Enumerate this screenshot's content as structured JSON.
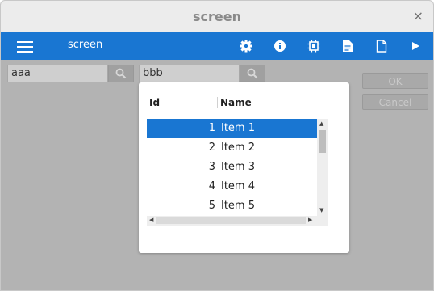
{
  "window": {
    "title": "screen",
    "close_glyph": "×"
  },
  "toolbar": {
    "app_name": "screen",
    "icons": [
      "menu-icon",
      "gear-icon",
      "info-icon",
      "chip-icon",
      "document-text-icon",
      "document-icon",
      "play-icon"
    ]
  },
  "search1": {
    "value": "aaa"
  },
  "search2": {
    "value": "bbb"
  },
  "buttons": {
    "ok": "OK",
    "cancel": "Cancel"
  },
  "popup": {
    "columns": {
      "id": "Id",
      "name": "Name"
    },
    "rows": [
      {
        "id": "1",
        "name": "Item 1",
        "selected": true
      },
      {
        "id": "2",
        "name": "Item 2"
      },
      {
        "id": "3",
        "name": "Item 3"
      },
      {
        "id": "4",
        "name": "Item 4"
      },
      {
        "id": "5",
        "name": "Item 5"
      }
    ]
  },
  "colors": {
    "accent": "#1976d2",
    "background_dim": "#b3b3b3",
    "title_text": "#8a8a8a"
  }
}
